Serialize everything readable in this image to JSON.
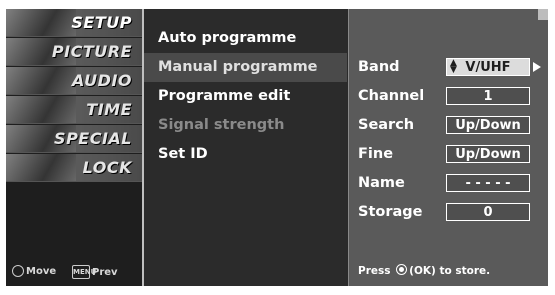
{
  "nav": {
    "items": [
      {
        "label": "SETUP",
        "active": true
      },
      {
        "label": "PICTURE",
        "active": false
      },
      {
        "label": "AUDIO",
        "active": false
      },
      {
        "label": "TIME",
        "active": false
      },
      {
        "label": "SPECIAL",
        "active": false
      },
      {
        "label": "LOCK",
        "active": false
      }
    ],
    "help": {
      "move_label": "Move",
      "menu_key": "MENU",
      "prev_label": "Prev"
    }
  },
  "submenu": {
    "items": [
      {
        "label": "Auto programme",
        "state": "normal"
      },
      {
        "label": "Manual programme",
        "state": "selected"
      },
      {
        "label": "Programme edit",
        "state": "normal"
      },
      {
        "label": "Signal strength",
        "state": "disabled"
      },
      {
        "label": "Set ID",
        "state": "normal"
      }
    ]
  },
  "panel": {
    "rows": [
      {
        "label": "Band",
        "value": "V/UHF",
        "selected": true
      },
      {
        "label": "Channel",
        "value": "1",
        "selected": false
      },
      {
        "label": "Search",
        "value": "Up/Down",
        "selected": false
      },
      {
        "label": "Fine",
        "value": "Up/Down",
        "selected": false
      },
      {
        "label": "Name",
        "value": "- - - - -",
        "selected": false
      },
      {
        "label": "Storage",
        "value": "0",
        "selected": false
      }
    ],
    "hint_prefix": "Press",
    "hint_key": "(OK)",
    "hint_suffix": "to store."
  },
  "colors": {
    "background": "#2b2b2b",
    "panel": "#5a5a5a",
    "selected_box": "#dcdcdc",
    "text": "#ffffff"
  }
}
